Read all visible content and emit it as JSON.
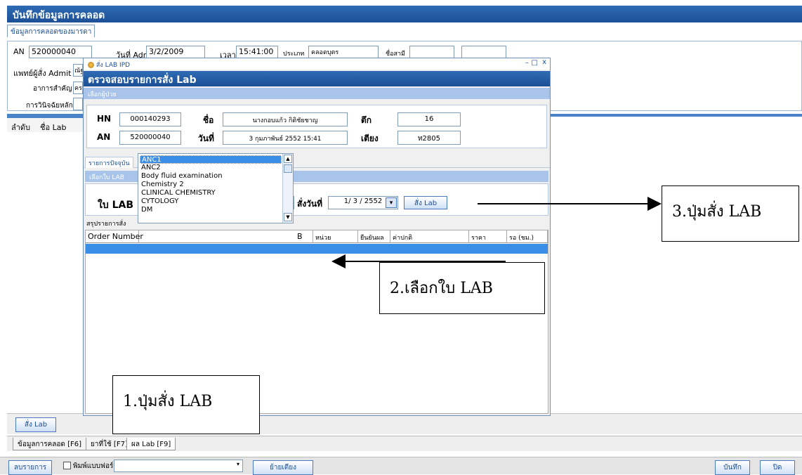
{
  "window": {
    "title": "บันทึกข้อมูลการคลอด",
    "tab": "ข้อมูลการคลอดของมารดา"
  },
  "form": {
    "an_label": "AN",
    "an_value": "520000040",
    "admit_date_label": "วันที่ Admit",
    "admit_date_value": "3/2/2009",
    "time_label": "เวลา",
    "time_value": "15:41:00",
    "type_label": "ประเภท",
    "type_value": "คลอดบุตร",
    "husband_label": "ชื่อสามี",
    "doctor_label": "แพทย์ผู้สั่ง Admit",
    "doctor_value": "ณัฐ",
    "symptom_label": "อาการสำคัญ",
    "symptom_value": "ครร",
    "diagnosis_label": "การวินิจฉัยหลัก"
  },
  "grid": {
    "col1": "ลำดับ",
    "col2": "ชื่อ Lab"
  },
  "footer": {
    "order_lab_button": "สั่ง Lab"
  },
  "bottom_tabs": [
    "ข้อมูลการคลอด [F6]",
    "ยาที่ใช้ [F7]",
    "ผล Lab [F9]"
  ],
  "statusbar": {
    "delete_button": "ลบรายการ",
    "print_form_label": "พิมพ์แบบฟอร์ม",
    "move_bed_button": "ย้ายเตียง",
    "save_button": "บันทึก",
    "close_button": "ปิด"
  },
  "dialog": {
    "window_title": "สั่ง LAB IPD",
    "window_controls": {
      "minimize": "–",
      "maximize": "□",
      "close": "x"
    },
    "header": "ตรวจสอบรายการสั่ง Lab",
    "patient_section": "เลือกผู้ป่วย",
    "hn_label": "HN",
    "hn_value": "000140293",
    "name_label": "ชื่อ",
    "name_value": "นางกอบแก้ว กิติชัยชาญ",
    "building_label": "ตึก",
    "building_value": "16",
    "an_label": "AN",
    "an_value": "520000040",
    "date_label": "วันที่",
    "date_value": "3 กุมภาพันธ์ 2552 15:41",
    "bed_label": "เตียง",
    "bed_value": "ท2805",
    "current_tab": "รายการปัจจุบัน",
    "lab_section": "เลือกใบ LAB",
    "lab_sheet_label": "ใบ LAB",
    "order_date_label": "สั่งวันที่",
    "order_date_value": "1/ 3 / 2552",
    "order_lab_button": "สั่ง Lab",
    "summary_tab": "สรุปรายการสั่ง",
    "table_headers": [
      "Order Number",
      "B",
      "หน่วย",
      "ยืนยันผล",
      "ค่าปกติ",
      "ราคา",
      "รอ (ชม.)"
    ],
    "dropdown_items": [
      "ANC1",
      "ANC2",
      "Body fluid examination",
      "Chemistry 2",
      "CLINICAL CHEMISTRY",
      "CYTOLOGY",
      "DM"
    ]
  },
  "annotations": {
    "step1": "1.ปุ่มสั่ง LAB",
    "step2": "2.เลือกใบ LAB",
    "step3": "3.ปุ่มสั่ง LAB"
  },
  "colors": {
    "accent": "#1c4f96",
    "selection": "#3a8ee6"
  }
}
